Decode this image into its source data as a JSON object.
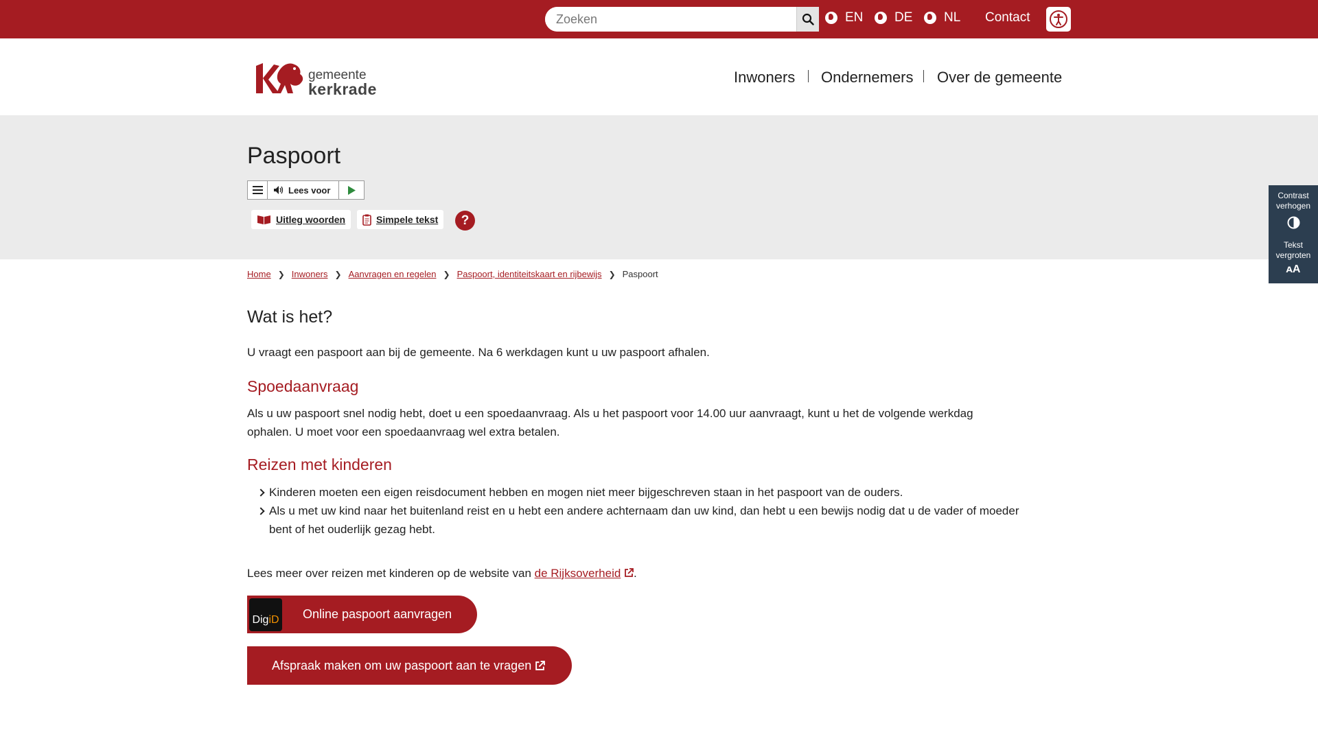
{
  "topbar": {
    "search_placeholder": "Zoeken",
    "languages": [
      "EN",
      "DE",
      "NL"
    ],
    "contact": "Contact"
  },
  "header": {
    "logo_line1": "gemeente",
    "logo_line2": "kerkrade",
    "nav": [
      "Inwoners",
      "Ondernemers",
      "Over de gemeente"
    ]
  },
  "hero": {
    "title": "Paspoort",
    "reader_label": "Lees voor",
    "tool_glossary": "Uitleg woorden",
    "tool_simple": "Simpele tekst",
    "help": "?"
  },
  "sidepanel": {
    "contrast_line1": "Contrast",
    "contrast_line2": "verhogen",
    "text_line1": "Tekst",
    "text_line2": "vergroten",
    "text_icon": "ᴀA"
  },
  "breadcrumb": [
    "Home",
    "Inwoners",
    "Aanvragen en regelen",
    "Paspoort, identiteitskaart en rijbewijs",
    "Paspoort"
  ],
  "content": {
    "h_what": "Wat is het?",
    "p_what": "U vraagt een paspoort aan bij de gemeente. Na 6 werkdagen kunt u uw paspoort afhalen.",
    "h_spoed": "Spoedaanvraag",
    "p_spoed_1": "Als u uw paspoort snel nodig hebt, doet u een spoedaanvraag. Als u het paspoort voor 14.00 uur aanvraagt, kunt u het de volgende werkdag",
    "p_spoed_2": "ophalen. U moet voor een spoedaanvraag wel extra betalen.",
    "h_kids": "Reizen met kinderen",
    "list": [
      "Kinderen moeten een eigen reisdocument hebben en mogen niet meer bijgeschreven staan in het paspoort van de ouders.",
      "Als u met uw kind naar het buitenland reist en u hebt een andere achternaam dan uw kind, dan hebt u een bewijs nodig dat u de vader of moeder",
      "bent of het ouderlijk gezag hebt."
    ],
    "p_more_prefix": "Lees meer over reizen met kinderen op de website van ",
    "p_more_link": "de Rijksoverheid",
    "p_more_suffix": ".",
    "btn_digid_logo_1": "Dig",
    "btn_digid_logo_2": "iD",
    "btn_online": "Online paspoort aanvragen",
    "btn_afspraak": "Afspraak maken om uw paspoort aan te vragen"
  },
  "colors": {
    "brand": "#a51c22",
    "hero_bg": "#ebebeb",
    "side_panel": "#2c3e50"
  }
}
